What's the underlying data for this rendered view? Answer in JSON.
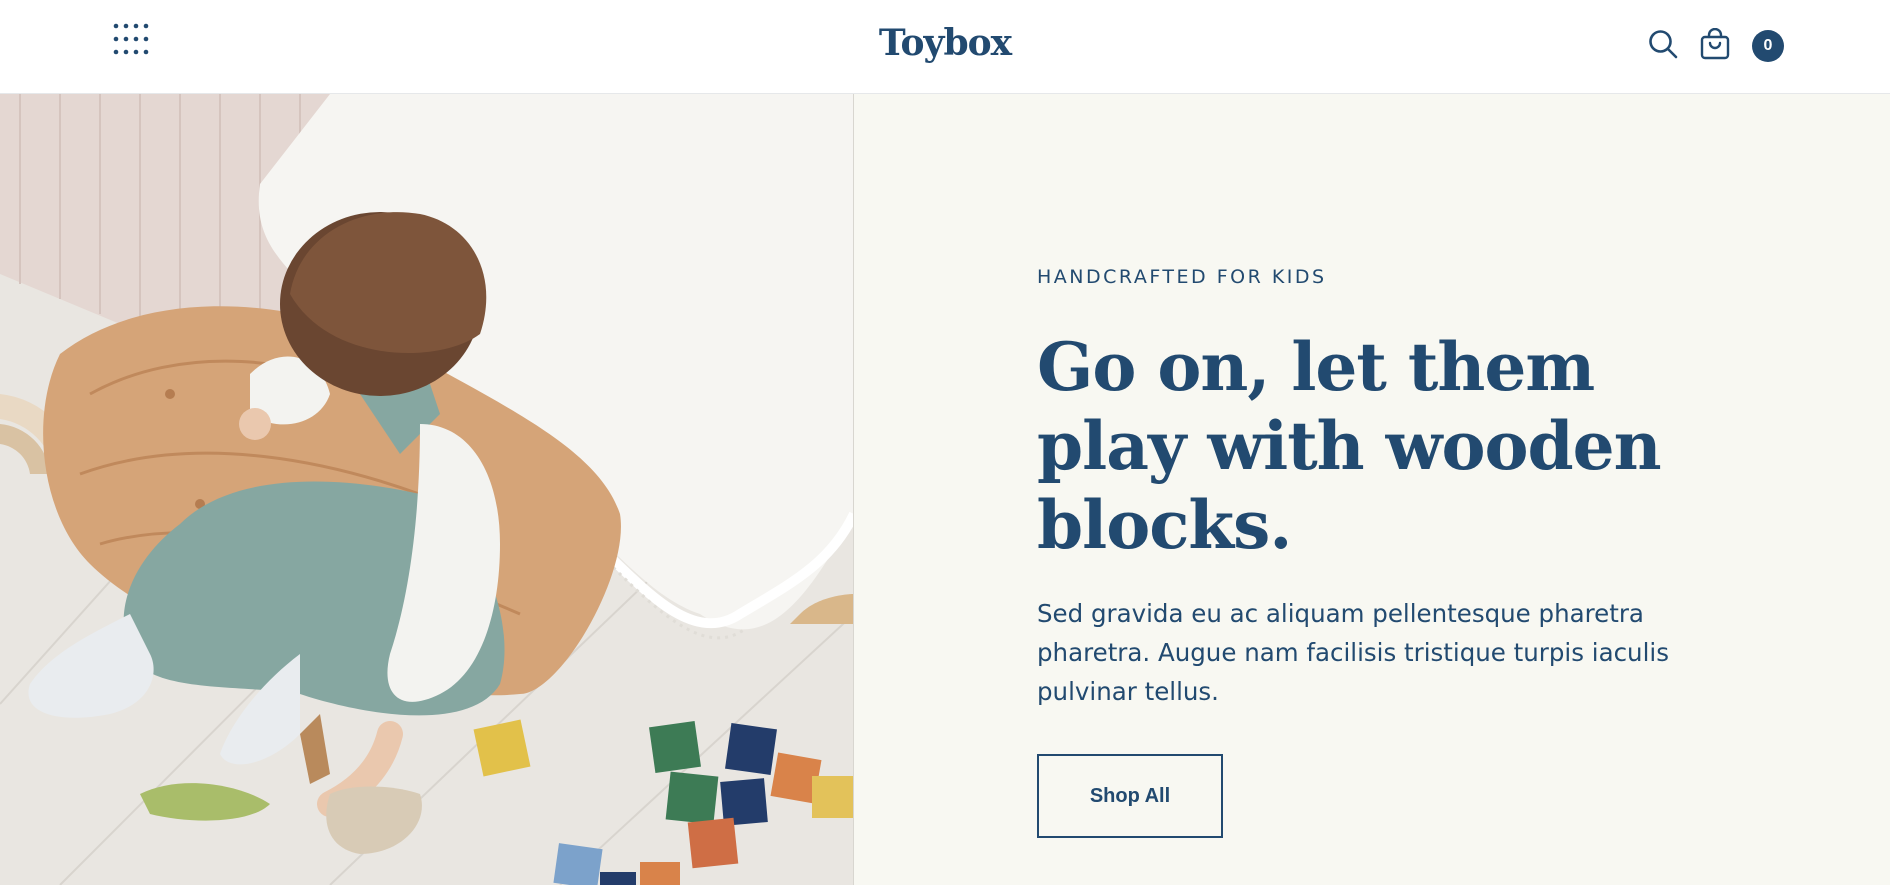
{
  "header": {
    "logo": "Toybox",
    "menu_icon": "grid-dots-icon",
    "search_icon": "search-icon",
    "cart_icon": "shopping-bag-icon",
    "cart_count": "0"
  },
  "hero": {
    "eyebrow": "HANDCRAFTED FOR KIDS",
    "headline": "Go on, let them play with wooden blocks.",
    "body": "Sed gravida eu ac aliquam pellentesque pharetra pharetra. Augue nam facilisis tristique turpis iaculis pulvinar tellus.",
    "button_label": "Shop All",
    "image": "photo of a toddler in green overalls sitting on a cushion playing with wooden blocks and animal toys"
  },
  "colors": {
    "brand_navy": "#224a70",
    "panel_background": "#f8f8f2",
    "header_background": "#ffffff"
  }
}
